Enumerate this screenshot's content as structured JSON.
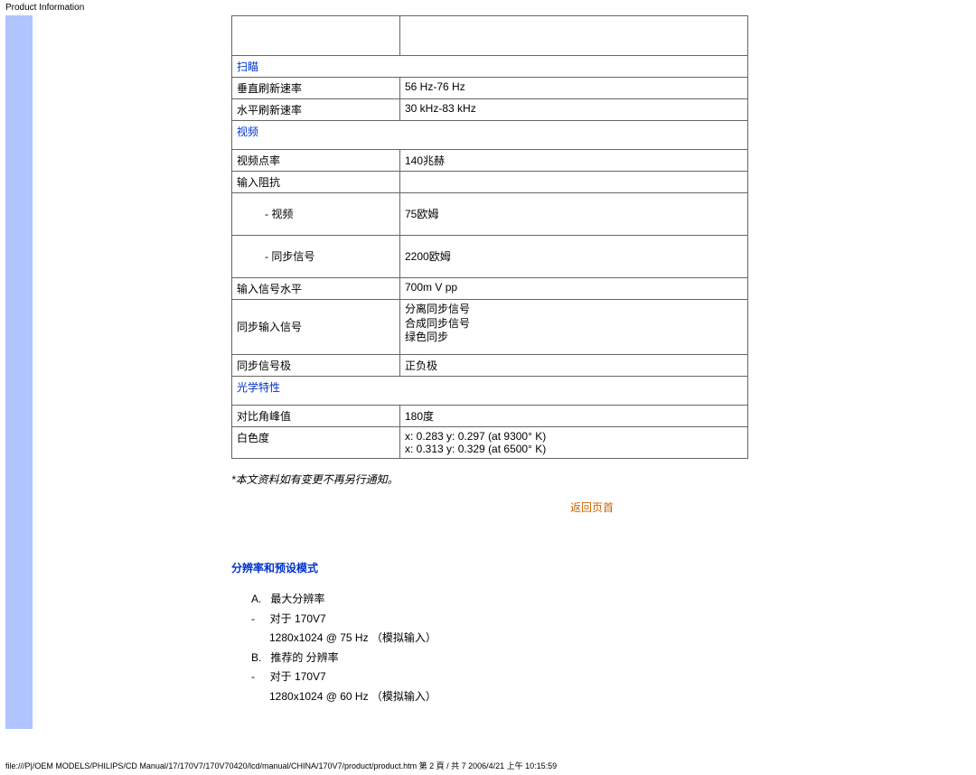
{
  "page_title": "Product Information",
  "sections": {
    "scan": {
      "header": "扫瞄",
      "rows": [
        {
          "label": "垂直刷新速率",
          "value": "56 Hz-76 Hz"
        },
        {
          "label": "水平刷新速率",
          "value": "30 kHz-83 kHz"
        }
      ]
    },
    "video": {
      "header": "视频",
      "rows": [
        {
          "label": "视频点率",
          "value": "140兆赫"
        },
        {
          "label": "输入阻抗",
          "value": ""
        },
        {
          "label": "- 视频",
          "value": "75欧姆",
          "indent": true,
          "tall": true
        },
        {
          "label": "- 同步信号",
          "value": "2200欧姆",
          "indent": true,
          "tall": true
        },
        {
          "label": "输入信号水平",
          "value": "700m V pp"
        },
        {
          "label": "同步输入信号",
          "value": "分离同步信号\n合成同步信号\n绿色同步",
          "tall": true
        },
        {
          "label": "同步信号极",
          "value": "正负极"
        }
      ]
    },
    "optics": {
      "header": "光学特性",
      "rows": [
        {
          "label": "对比角峰值",
          "value": "180度"
        },
        {
          "label": "白色度",
          "value": "x: 0.283 y: 0.297 (at 9300°  K)\nx: 0.313 y: 0.329 (at 6500°  K)"
        }
      ]
    }
  },
  "note": "*本文资料如有变更不再另行通知。",
  "back_link": "返回页首",
  "resolution_heading": "分辨率和预设模式",
  "resolution_list": [
    "A.   最大分辨率",
    "-     对于 170V7",
    "      1280x1024 @ 75 Hz （模拟输入）",
    "B.   推荐的 分辨率",
    "-     对于 170V7",
    "      1280x1024 @ 60 Hz （模拟输入）"
  ],
  "footer_path": "file:///P|/OEM MODELS/PHILIPS/CD Manual/17/170V7/170V70420/lcd/manual/CHINA/170V7/product/product.htm 第 2 頁 / 共 7 2006/4/21 上午 10:15:59"
}
